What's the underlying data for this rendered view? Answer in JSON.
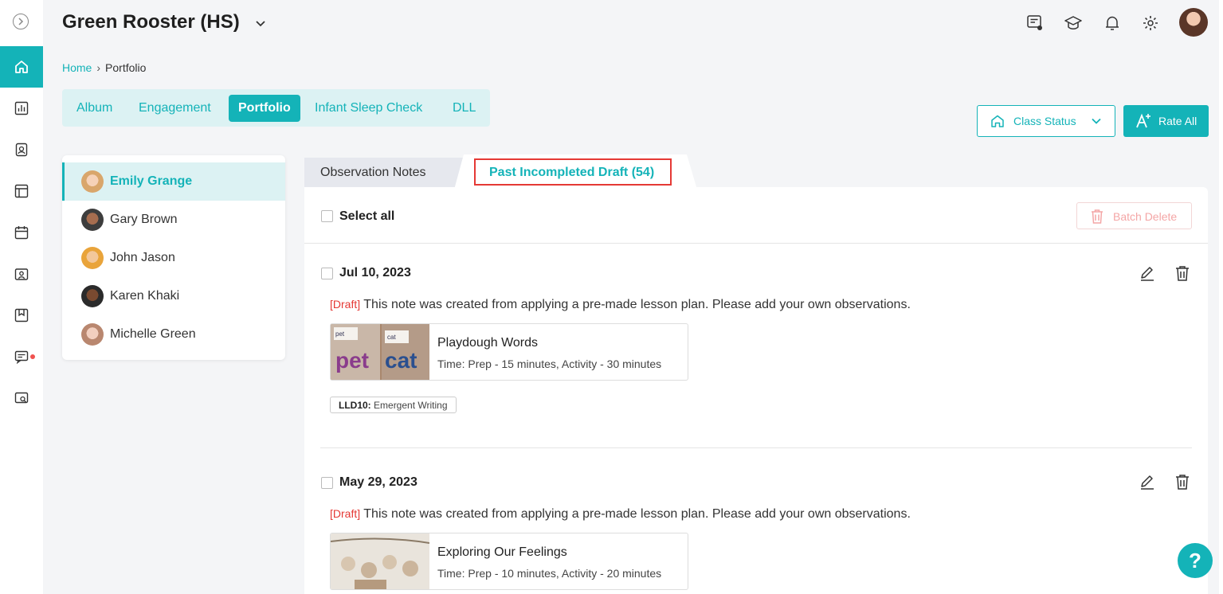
{
  "header": {
    "title": "Green Rooster (HS)",
    "icons": [
      "chat-icon",
      "graduation-icon",
      "bell-icon",
      "gear-icon"
    ]
  },
  "breadcrumb": {
    "home": "Home",
    "current": "Portfolio"
  },
  "tabs": [
    {
      "label": "Album"
    },
    {
      "label": "Engagement"
    },
    {
      "label": "Portfolio"
    },
    {
      "label": "Infant Sleep Check"
    },
    {
      "label": "DLL"
    }
  ],
  "buttons": {
    "class_status": "Class Status",
    "rate_all": "Rate All"
  },
  "children": [
    {
      "name": "Emily Grange"
    },
    {
      "name": "Gary Brown"
    },
    {
      "name": "John Jason"
    },
    {
      "name": "Karen Khaki"
    },
    {
      "name": "Michelle Green"
    }
  ],
  "subtabs": {
    "observation": "Observation Notes",
    "drafts": "Past Incompleted Draft (54)"
  },
  "panel": {
    "select_all": "Select all",
    "batch_delete": "Batch Delete"
  },
  "notes": [
    {
      "date": "Jul 10, 2023",
      "draft_tag": "[Draft]",
      "text": "This note was created from applying a pre-made lesson plan. Please add your own observations.",
      "lesson_title": "Playdough Words",
      "lesson_time": "Time: Prep - 15 minutes, Activity - 30 minutes",
      "tag_code": "LLD10:",
      "tag_label": "Emergent Writing",
      "thumb_words": [
        "pet",
        "cat"
      ]
    },
    {
      "date": "May 29, 2023",
      "draft_tag": "[Draft]",
      "text": "This note was created from applying a pre-made lesson plan. Please add your own observations.",
      "lesson_title": "Exploring Our Feelings",
      "lesson_time": "Time: Prep - 10 minutes, Activity - 20 minutes"
    }
  ],
  "help": "?",
  "colors": {
    "accent": "#14b3b8",
    "accent_light": "#dcf2f3",
    "draft_red": "#e53935"
  }
}
